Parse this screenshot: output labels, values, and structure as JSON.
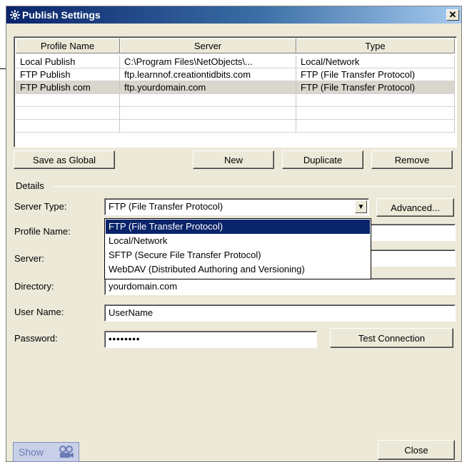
{
  "window": {
    "title": "Publish Settings",
    "close_glyph": "✕"
  },
  "table": {
    "columns": [
      "Profile Name",
      "Server",
      "Type"
    ],
    "rows": [
      [
        "Local Publish",
        "C:\\Program Files\\NetObjects\\...",
        "Local/Network"
      ],
      [
        "FTP Publish",
        "ftp.learnnof.creationtidbits.com",
        "FTP (File Transfer Protocol)"
      ],
      [
        "FTP Publish com",
        "ftp.yourdomain.com",
        "FTP (File Transfer Protocol)"
      ]
    ],
    "selected_row": 2,
    "empty_rows": 3
  },
  "buttons": {
    "save_global": "Save as Global",
    "new": "New",
    "duplicate": "Duplicate",
    "remove": "Remove",
    "advanced": "Advanced...",
    "test_connection": "Test Connection",
    "show": "Show",
    "close": "Close"
  },
  "details": {
    "legend": "Details",
    "server_type_label": "Server Type:",
    "server_type_value": "FTP (File Transfer Protocol)",
    "profile_name_label": "Profile Name:",
    "server_label": "Server:",
    "directory_label": "Directory:",
    "directory_value": "yourdomain.com",
    "user_name_label": "User Name:",
    "user_name_value": "UserName",
    "password_label": "Password:",
    "password_value": "••••••••"
  },
  "dropdown": {
    "options": [
      "FTP (File Transfer Protocol)",
      "Local/Network",
      "SFTP (Secure File Transfer Protocol)",
      "WebDAV (Distributed Authoring and Versioning)"
    ],
    "highlighted_index": 0
  },
  "icons": {
    "title_icon": "gear-icon",
    "show_icon": "camera-icon",
    "dropdown_arrow": "chevron-down-icon"
  },
  "colors": {
    "titlebar_start": "#0a246a",
    "titlebar_end": "#a6caf0",
    "dialog_bg": "#ece9d8",
    "highlight": "#0a246a"
  }
}
